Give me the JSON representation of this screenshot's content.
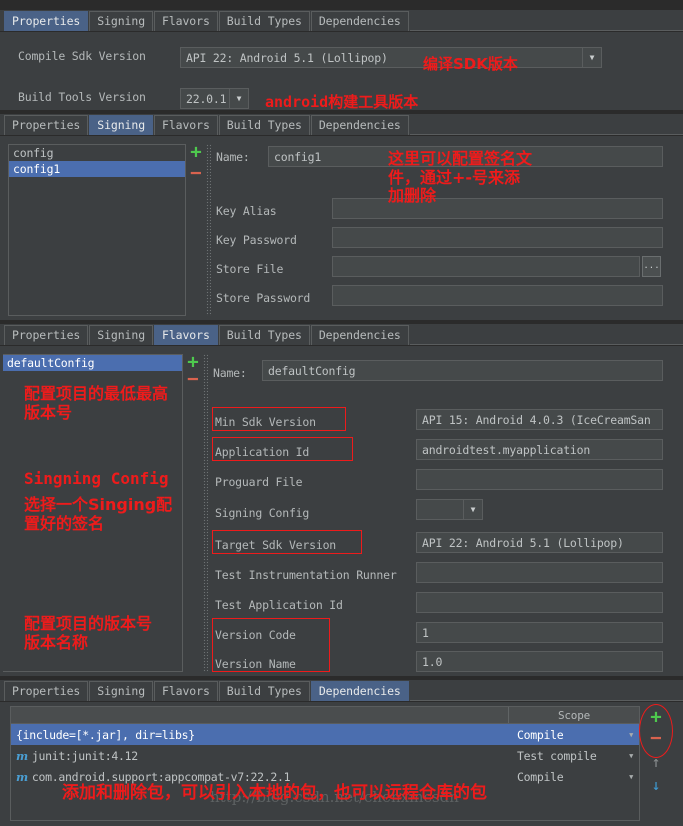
{
  "tabs": [
    "Properties",
    "Signing",
    "Flavors",
    "Build Types",
    "Dependencies"
  ],
  "properties_panel": {
    "active_tab": "Properties",
    "rows": [
      {
        "label": "Compile Sdk Version",
        "value": "API 22: Android 5.1 (Lollipop)",
        "control": "combobox"
      },
      {
        "label": "Build Tools Version",
        "value": "22.0.1",
        "control": "combobox"
      }
    ],
    "annotations": [
      {
        "text": "编译SDK版本"
      },
      {
        "text": "android构建工具版本"
      }
    ]
  },
  "signing_panel": {
    "active_tab": "Signing",
    "list": [
      {
        "label": "config",
        "selected": false
      },
      {
        "label": "config1",
        "selected": true
      }
    ],
    "add_label": "+",
    "remove_label": "−",
    "name_label": "Name:",
    "name_value": "config1",
    "rows": [
      {
        "label": "Key Alias",
        "value": ""
      },
      {
        "label": "Key Password",
        "value": ""
      },
      {
        "label": "Store File",
        "value": "",
        "browse": "..."
      },
      {
        "label": "Store Password",
        "value": ""
      }
    ],
    "annotation": "这里可以配置签名文\n件，通过+-号来添\n加删除"
  },
  "flavors_panel": {
    "active_tab": "Flavors",
    "list": [
      {
        "label": "defaultConfig",
        "selected": true
      }
    ],
    "add_label": "+",
    "remove_label": "−",
    "name_label": "Name:",
    "name_value": "defaultConfig",
    "rows": [
      {
        "label": "Min Sdk Version",
        "value": "API 15: Android 4.0.3 (IceCreamSan",
        "highlight": true
      },
      {
        "label": "Application Id",
        "value": "androidtest.myapplication",
        "highlight": true
      },
      {
        "label": "Proguard File",
        "value": ""
      },
      {
        "label": "Signing Config",
        "value": "",
        "control": "combobox-small"
      },
      {
        "label": "Target Sdk Version",
        "value": "API 22: Android 5.1 (Lollipop)",
        "highlight": true
      },
      {
        "label": "Test Instrumentation Runner",
        "value": ""
      },
      {
        "label": "Test Application Id",
        "value": ""
      },
      {
        "label": "Version Code",
        "value": "1",
        "highlight": true
      },
      {
        "label": "Version Name",
        "value": "1.0",
        "highlight": true
      }
    ],
    "annotations": [
      "配置项目的最低最高\n版本号",
      "Singning Config",
      "选择一个Singing配\n置好的签名",
      "配置项目的版本号\n版本名称"
    ]
  },
  "dependencies_panel": {
    "active_tab": "Dependencies",
    "columns": [
      "",
      "Scope"
    ],
    "rows": [
      {
        "icon": "",
        "name": "{include=[*.jar], dir=libs}",
        "scope": "Compile",
        "selected": true
      },
      {
        "icon": "m",
        "name": "junit:junit:4.12",
        "scope": "Test compile",
        "selected": false
      },
      {
        "icon": "m",
        "name": "com.android.support:appcompat-v7:22.2.1",
        "scope": "Compile",
        "selected": false
      }
    ],
    "add_label": "+",
    "remove_label": "−",
    "move_up_label": "↑",
    "move_down_label": "↓",
    "annotation": "添加和删除包，可以引入本地的包，也可以远程仓库的包"
  },
  "watermark": "http://blog.csdn.net/chenxincsdn",
  "colors": {
    "panel_bg": "#3c3f41",
    "field_bg": "#45494a",
    "selection": "#4b6eaf",
    "tab_active": "#4a6287",
    "annotation_red": "#ee1b1b",
    "plus_green": "#4ec94e",
    "minus_red": "#d9634f",
    "module_icon_blue": "#4a9fd4"
  }
}
